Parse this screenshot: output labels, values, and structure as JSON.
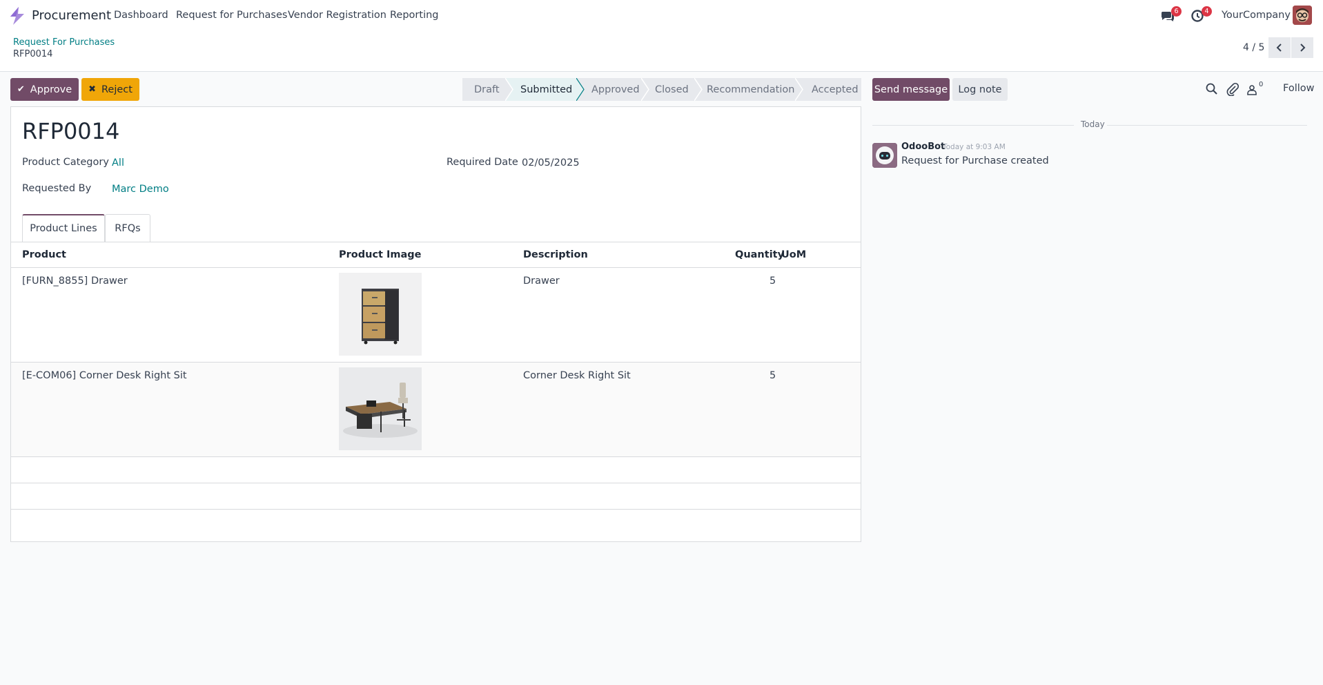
{
  "navbar": {
    "app_name": "Procurement",
    "menu": [
      "Dashboard",
      "Request for Purchases",
      "Vendor Registration",
      "Reporting"
    ],
    "messages_badge": "6",
    "activities_badge": "4",
    "company": "YourCompany"
  },
  "control": {
    "breadcrumb": "Request For Purchases",
    "current": "RFP0014",
    "pager": "4 / 5"
  },
  "actions": {
    "approve": "Approve",
    "reject": "Reject"
  },
  "statusbar": [
    "Draft",
    "Submitted",
    "Approved",
    "Closed",
    "Recommendation",
    "Accepted"
  ],
  "statusbar_active": "Submitted",
  "form": {
    "title": "RFP0014",
    "product_category_label": "Product Category",
    "product_category_value": "All",
    "required_date_label": "Required Date",
    "required_date_value": "02/05/2025",
    "requested_by_label": "Requested By",
    "requested_by_value": "Marc Demo",
    "tabs": [
      "Product Lines",
      "RFQs"
    ],
    "columns": [
      "Product",
      "Product Image",
      "Description",
      "Quantity",
      "UoM"
    ],
    "lines": [
      {
        "product": "[FURN_8855] Drawer",
        "description": "Drawer",
        "quantity": "5",
        "uom": ""
      },
      {
        "product": "[E-COM06] Corner Desk Right Sit",
        "description": "Corner Desk Right Sit",
        "quantity": "5",
        "uom": ""
      }
    ]
  },
  "chatter": {
    "send_message": "Send message",
    "log_note": "Log note",
    "followers_count": "0",
    "follow": "Follow",
    "separator": "Today",
    "messages": [
      {
        "author": "OdooBot",
        "date": "Today at 9:03 AM",
        "body": "Request for Purchase created"
      }
    ]
  },
  "colors": {
    "brand": "#714b67",
    "link": "#017e84",
    "warning": "#f0a608",
    "badge": "#dc3545"
  }
}
